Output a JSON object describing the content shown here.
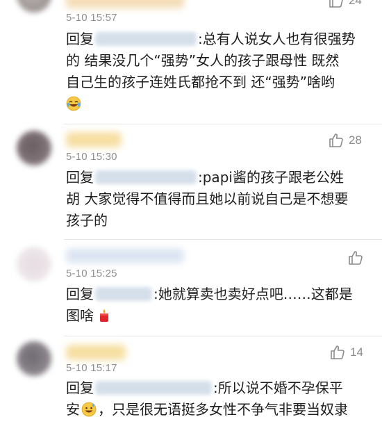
{
  "comments": [
    {
      "time": "5-10 15:57",
      "likes": "24",
      "reply_prefix": "回复",
      "lines": [
        ":总有人说女人也有很强势",
        "的 结果没几个“强势”女人的孩子跟母性 既然",
        "自己生的孩子连姓氏都抢不到 还“强势”啥哟"
      ],
      "emoji_icon": "laughing-tears-emoji-icon"
    },
    {
      "time": "5-10 15:30",
      "likes": "28",
      "reply_prefix": "回复",
      "lines": [
        ":papi酱的孩子跟老公姓",
        "胡 大家觉得不值得而且她以前说自己是不想要",
        "孩子的"
      ]
    },
    {
      "time": "5-10 15:25",
      "likes": "",
      "reply_prefix": "回复",
      "lines": [
        ":她就算卖也卖好点吧……这都是",
        "图啥"
      ],
      "emoji_icon": "red-candle-emoji-icon"
    },
    {
      "time": "5-10 15:17",
      "likes": "14",
      "reply_prefix": "回复",
      "lines": [
        ":所以说不婚不孕保平",
        "，只是很无语挺多女性不争气非要当奴隶"
      ],
      "line2_prefix": "安",
      "emoji_icon": "grinning-sweat-emoji-icon"
    }
  ],
  "colors": {
    "time": "#8f8f8f",
    "like": "#8a8a8a",
    "mention_blur": "#d5dfea",
    "divider": "#e6e6e6"
  }
}
